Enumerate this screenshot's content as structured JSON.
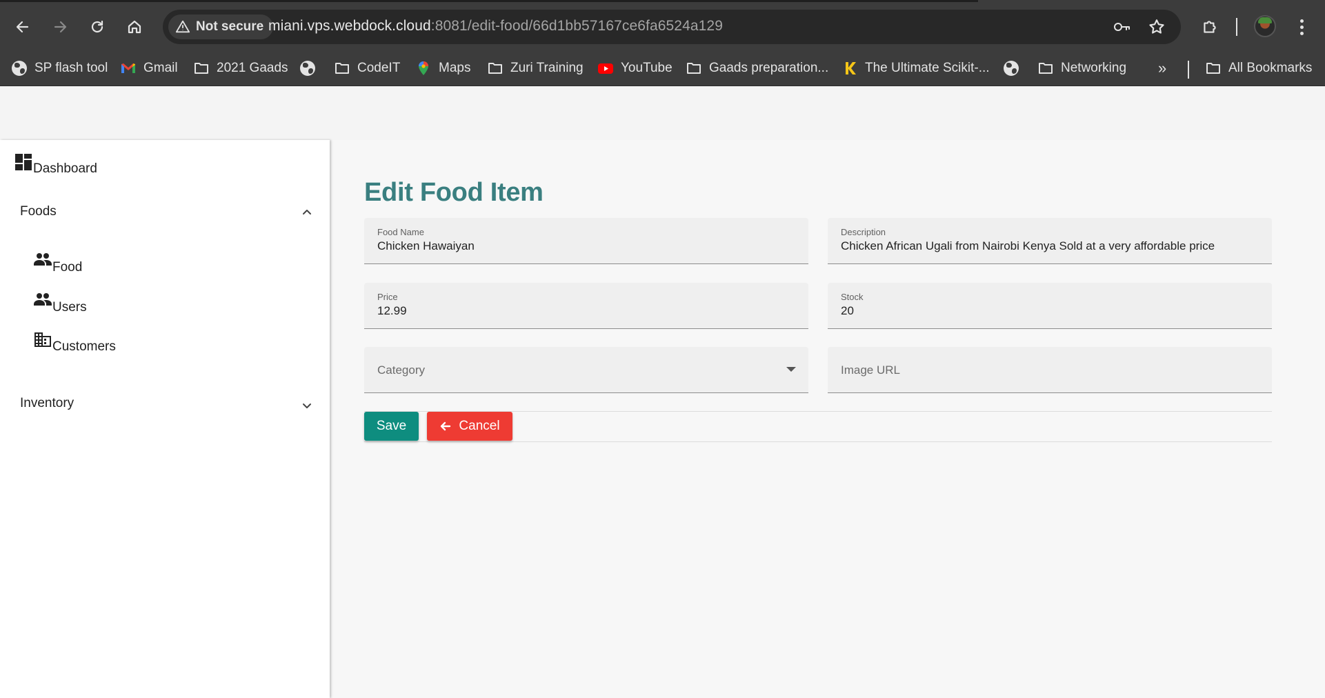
{
  "browser": {
    "security_label": "Not secure",
    "url_host": "miani.vps.webdock.cloud",
    "url_rest": ":8081/edit-food/66d1bb57167ce6fa6524a129",
    "bookmarks": [
      {
        "label": "SP flash tool",
        "icon": "globe-icon"
      },
      {
        "label": "Gmail",
        "icon": "gmail-icon"
      },
      {
        "label": "2021 Gaads",
        "icon": "folder-icon"
      },
      {
        "label": "",
        "icon": "globe-icon"
      },
      {
        "label": "CodeIT",
        "icon": "folder-icon"
      },
      {
        "label": "Maps",
        "icon": "maps-icon"
      },
      {
        "label": "Zuri Training",
        "icon": "folder-icon"
      },
      {
        "label": "YouTube",
        "icon": "youtube-icon"
      },
      {
        "label": "Gaads preparation...",
        "icon": "folder-icon"
      },
      {
        "label": "The Ultimate Scikit-...",
        "icon": "kaggle-icon"
      },
      {
        "label": "",
        "icon": "globe-icon"
      },
      {
        "label": "Networking",
        "icon": "folder-icon"
      }
    ],
    "more_bookmarks": "»",
    "all_bookmarks": "All Bookmarks"
  },
  "sidebar": {
    "dashboard": "Dashboard",
    "foods_group": "Foods",
    "foods_items": [
      {
        "label": "Food",
        "icon": "people-icon"
      },
      {
        "label": "Users",
        "icon": "people-icon"
      },
      {
        "label": "Customers",
        "icon": "business-icon"
      }
    ],
    "inventory_group": "Inventory"
  },
  "page": {
    "title": "Edit Food Item",
    "fields": {
      "food_name": {
        "label": "Food Name",
        "value": "Chicken Hawaiyan"
      },
      "description": {
        "label": "Description",
        "value": "Chicken African Ugali from Nairobi Kenya Sold at a very affordable price"
      },
      "price": {
        "label": "Price",
        "value": "12.99"
      },
      "stock": {
        "label": "Stock",
        "value": "20"
      },
      "category": {
        "placeholder": "Category"
      },
      "image_url": {
        "placeholder": "Image URL"
      }
    },
    "save_label": "Save",
    "cancel_label": "Cancel"
  },
  "colors": {
    "title": "#3a7f80",
    "save": "#0e8d7f",
    "cancel": "#ee3b33",
    "chrome": "#3c3c3c"
  }
}
